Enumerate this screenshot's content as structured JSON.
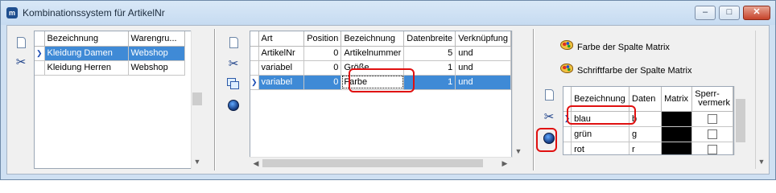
{
  "window": {
    "app_icon_letter": "m",
    "title": "Kombinationssystem für ArtikelNr",
    "minimize": "‒",
    "maximize": "□",
    "close": "✕"
  },
  "left_grid": {
    "columns": [
      "Bezeichnung",
      "Warengru..."
    ],
    "rows": [
      [
        "Kleidung Damen",
        "Webshop"
      ],
      [
        "Kleidung Herren",
        "Webshop"
      ]
    ],
    "selected_row": 0
  },
  "middle_grid": {
    "columns": [
      "Art",
      "Position",
      "Bezeichnung",
      "Datenbreite",
      "Verknüpfung"
    ],
    "rows": [
      [
        "ArtikelNr",
        "0",
        "Artikelnummer",
        "5",
        "und"
      ],
      [
        "variabel",
        "0",
        "Größe",
        "1",
        "und"
      ],
      [
        "variabel",
        "0",
        "Farbe",
        "1",
        "und"
      ]
    ],
    "selected_row": 2
  },
  "right_panel": {
    "color_button": "Farbe der Spalte Matrix",
    "font_color_button": "Schriftfarbe der Spalte Matrix",
    "columns": [
      "Bezeichnung",
      "Daten",
      "Matrix",
      "Sperr-\nvermerk"
    ],
    "columns_line2": "vermerk",
    "sperr_line1": "Sperr-",
    "rows": [
      [
        "blau",
        "b",
        "",
        ""
      ],
      [
        "grün",
        "g",
        "",
        ""
      ],
      [
        "rot",
        "r",
        "",
        ""
      ]
    ]
  },
  "colors": {
    "selection": "#3f8ad6",
    "highlight_ring": "#e01010",
    "matrix_cell": "#000000"
  },
  "icons": [
    "new-document-icon",
    "scissors-icon",
    "copy-icon",
    "globe-icon",
    "palette-icon"
  ]
}
